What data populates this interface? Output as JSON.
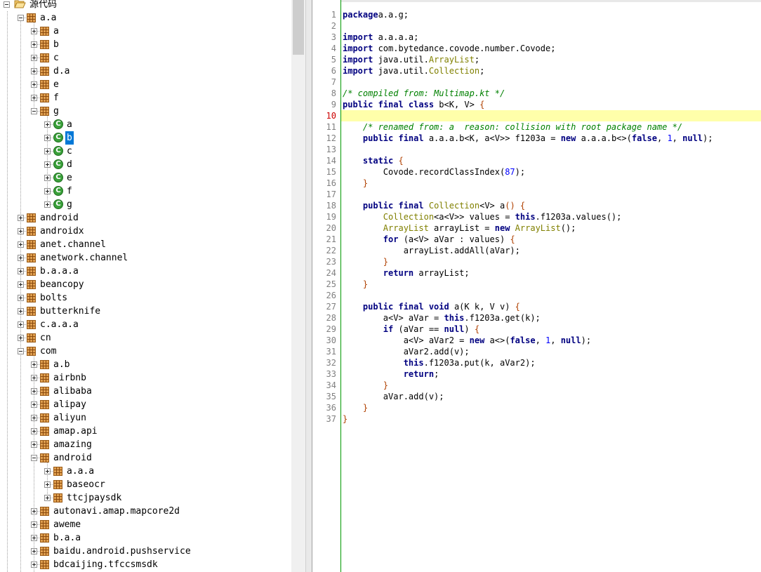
{
  "tree": {
    "root_label": "源代码",
    "nodes": [
      {
        "label": "a.a",
        "depth": 1,
        "type": "pkg",
        "expanded": true
      },
      {
        "label": "a",
        "depth": 2,
        "type": "pkg",
        "expanded": false
      },
      {
        "label": "b",
        "depth": 2,
        "type": "pkg",
        "expanded": false
      },
      {
        "label": "c",
        "depth": 2,
        "type": "pkg",
        "expanded": false
      },
      {
        "label": "d.a",
        "depth": 2,
        "type": "pkg",
        "expanded": false
      },
      {
        "label": "e",
        "depth": 2,
        "type": "pkg",
        "expanded": false
      },
      {
        "label": "f",
        "depth": 2,
        "type": "pkg",
        "expanded": false
      },
      {
        "label": "g",
        "depth": 2,
        "type": "pkg",
        "expanded": true
      },
      {
        "label": "a",
        "depth": 3,
        "type": "class",
        "expanded": false
      },
      {
        "label": "b",
        "depth": 3,
        "type": "class",
        "expanded": false,
        "selected": true
      },
      {
        "label": "c",
        "depth": 3,
        "type": "class",
        "expanded": false
      },
      {
        "label": "d",
        "depth": 3,
        "type": "class",
        "expanded": false
      },
      {
        "label": "e",
        "depth": 3,
        "type": "class",
        "expanded": false
      },
      {
        "label": "f",
        "depth": 3,
        "type": "class",
        "expanded": false
      },
      {
        "label": "g",
        "depth": 3,
        "type": "class",
        "expanded": false
      },
      {
        "label": "android",
        "depth": 1,
        "type": "pkg",
        "expanded": false
      },
      {
        "label": "androidx",
        "depth": 1,
        "type": "pkg",
        "expanded": false
      },
      {
        "label": "anet.channel",
        "depth": 1,
        "type": "pkg",
        "expanded": false
      },
      {
        "label": "anetwork.channel",
        "depth": 1,
        "type": "pkg",
        "expanded": false
      },
      {
        "label": "b.a.a.a",
        "depth": 1,
        "type": "pkg",
        "expanded": false
      },
      {
        "label": "beancopy",
        "depth": 1,
        "type": "pkg",
        "expanded": false
      },
      {
        "label": "bolts",
        "depth": 1,
        "type": "pkg",
        "expanded": false
      },
      {
        "label": "butterknife",
        "depth": 1,
        "type": "pkg",
        "expanded": false
      },
      {
        "label": "c.a.a.a",
        "depth": 1,
        "type": "pkg",
        "expanded": false
      },
      {
        "label": "cn",
        "depth": 1,
        "type": "pkg",
        "expanded": false
      },
      {
        "label": "com",
        "depth": 1,
        "type": "pkg",
        "expanded": true
      },
      {
        "label": "a.b",
        "depth": 2,
        "type": "pkg",
        "expanded": false
      },
      {
        "label": "airbnb",
        "depth": 2,
        "type": "pkg",
        "expanded": false
      },
      {
        "label": "alibaba",
        "depth": 2,
        "type": "pkg",
        "expanded": false
      },
      {
        "label": "alipay",
        "depth": 2,
        "type": "pkg",
        "expanded": false
      },
      {
        "label": "aliyun",
        "depth": 2,
        "type": "pkg",
        "expanded": false
      },
      {
        "label": "amap.api",
        "depth": 2,
        "type": "pkg",
        "expanded": false
      },
      {
        "label": "amazing",
        "depth": 2,
        "type": "pkg",
        "expanded": false
      },
      {
        "label": "android",
        "depth": 2,
        "type": "pkg",
        "expanded": true
      },
      {
        "label": "a.a.a",
        "depth": 3,
        "type": "pkg",
        "expanded": false
      },
      {
        "label": "baseocr",
        "depth": 3,
        "type": "pkg",
        "expanded": false
      },
      {
        "label": "ttcjpaysdk",
        "depth": 3,
        "type": "pkg",
        "expanded": false
      },
      {
        "label": "autonavi.amap.mapcore2d",
        "depth": 2,
        "type": "pkg",
        "expanded": false
      },
      {
        "label": "aweme",
        "depth": 2,
        "type": "pkg",
        "expanded": false
      },
      {
        "label": "b.a.a",
        "depth": 2,
        "type": "pkg",
        "expanded": false
      },
      {
        "label": "baidu.android.pushservice",
        "depth": 2,
        "type": "pkg",
        "expanded": false
      },
      {
        "label": "bdcaijing.tfccsmsdk",
        "depth": 2,
        "type": "pkg",
        "expanded": false
      }
    ]
  },
  "editor": {
    "highlighted_line": 10,
    "lines": [
      [
        [
          "k",
          "package"
        ],
        [
          "",
          "a.a.g;"
        ]
      ],
      [],
      [
        [
          "k",
          "import"
        ],
        [
          "",
          " a.a.a.a;"
        ]
      ],
      [
        [
          "k",
          "import"
        ],
        [
          "",
          " com.bytedance.covode.number.Covode;"
        ]
      ],
      [
        [
          "k",
          "import"
        ],
        [
          "",
          " java.util."
        ],
        [
          "t",
          "ArrayList"
        ],
        [
          "",
          ";"
        ]
      ],
      [
        [
          "k",
          "import"
        ],
        [
          "",
          " java.util."
        ],
        [
          "t",
          "Collection"
        ],
        [
          "",
          ";"
        ]
      ],
      [],
      [
        [
          "c",
          "/* compiled from: Multimap.kt */"
        ]
      ],
      [
        [
          "k",
          "public final class"
        ],
        [
          "",
          " b<K, V> "
        ],
        [
          "p",
          "{"
        ]
      ],
      [],
      [
        [
          "",
          "    "
        ],
        [
          "c",
          "/* renamed from: a  reason: collision with root package name */"
        ]
      ],
      [
        [
          "",
          "    "
        ],
        [
          "k",
          "public final"
        ],
        [
          "",
          " a.a.a.b<K, a<V>> f1203a = "
        ],
        [
          "k",
          "new"
        ],
        [
          "",
          " a.a.a.b<>("
        ],
        [
          "k",
          "false"
        ],
        [
          "",
          ", "
        ],
        [
          "n",
          "1"
        ],
        [
          "",
          ", "
        ],
        [
          "k",
          "null"
        ],
        [
          "",
          ");"
        ]
      ],
      [],
      [
        [
          "",
          "    "
        ],
        [
          "k",
          "static"
        ],
        [
          "",
          " "
        ],
        [
          "p",
          "{"
        ]
      ],
      [
        [
          "",
          "        Covode.recordClassIndex("
        ],
        [
          "n",
          "87"
        ],
        [
          "",
          ");"
        ]
      ],
      [
        [
          "",
          "    "
        ],
        [
          "p",
          "}"
        ]
      ],
      [],
      [
        [
          "",
          "    "
        ],
        [
          "k",
          "public final"
        ],
        [
          "",
          " "
        ],
        [
          "t",
          "Collection"
        ],
        [
          "",
          "<V> a"
        ],
        [
          "p",
          "()"
        ],
        [
          "",
          " "
        ],
        [
          "p",
          "{"
        ]
      ],
      [
        [
          "",
          "        "
        ],
        [
          "t",
          "Collection"
        ],
        [
          "",
          "<a<V>> values = "
        ],
        [
          "k",
          "this"
        ],
        [
          "",
          ".f1203a.values();"
        ]
      ],
      [
        [
          "",
          "        "
        ],
        [
          "t",
          "ArrayList"
        ],
        [
          "",
          " arrayList = "
        ],
        [
          "k",
          "new"
        ],
        [
          "",
          " "
        ],
        [
          "t",
          "ArrayList"
        ],
        [
          "",
          "();"
        ]
      ],
      [
        [
          "",
          "        "
        ],
        [
          "k",
          "for"
        ],
        [
          "",
          " (a<V> aVar : values) "
        ],
        [
          "p",
          "{"
        ]
      ],
      [
        [
          "",
          "            arrayList.addAll(aVar);"
        ]
      ],
      [
        [
          "",
          "        "
        ],
        [
          "p",
          "}"
        ]
      ],
      [
        [
          "",
          "        "
        ],
        [
          "k",
          "return"
        ],
        [
          "",
          " arrayList;"
        ]
      ],
      [
        [
          "",
          "    "
        ],
        [
          "p",
          "}"
        ]
      ],
      [],
      [
        [
          "",
          "    "
        ],
        [
          "k",
          "public final void"
        ],
        [
          "",
          " a(K k, V v) "
        ],
        [
          "p",
          "{"
        ]
      ],
      [
        [
          "",
          "        a<V> aVar = "
        ],
        [
          "k",
          "this"
        ],
        [
          "",
          ".f1203a.get(k);"
        ]
      ],
      [
        [
          "",
          "        "
        ],
        [
          "k",
          "if"
        ],
        [
          "",
          " (aVar == "
        ],
        [
          "k",
          "null"
        ],
        [
          "",
          ") "
        ],
        [
          "p",
          "{"
        ]
      ],
      [
        [
          "",
          "            a<V> aVar2 = "
        ],
        [
          "k",
          "new"
        ],
        [
          "",
          " a<>("
        ],
        [
          "k",
          "false"
        ],
        [
          "",
          ", "
        ],
        [
          "n",
          "1"
        ],
        [
          "",
          ", "
        ],
        [
          "k",
          "null"
        ],
        [
          "",
          ");"
        ]
      ],
      [
        [
          "",
          "            aVar2.add(v);"
        ]
      ],
      [
        [
          "",
          "            "
        ],
        [
          "k",
          "this"
        ],
        [
          "",
          ".f1203a.put(k, aVar2);"
        ]
      ],
      [
        [
          "",
          "            "
        ],
        [
          "k",
          "return"
        ],
        [
          "",
          ";"
        ]
      ],
      [
        [
          "",
          "        "
        ],
        [
          "p",
          "}"
        ]
      ],
      [
        [
          "",
          "        aVar.add(v);"
        ]
      ],
      [
        [
          "",
          "    "
        ],
        [
          "p",
          "}"
        ]
      ],
      [
        [
          "p",
          "}"
        ]
      ]
    ]
  }
}
